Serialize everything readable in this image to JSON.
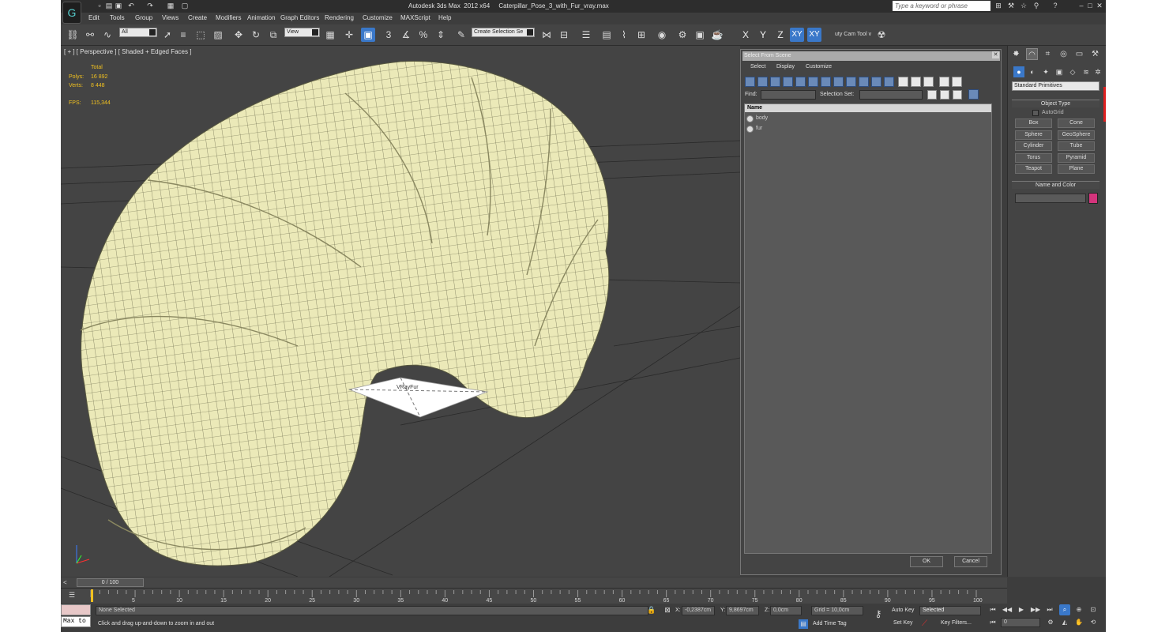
{
  "title": {
    "app": "Autodesk 3ds Max  2012 x64",
    "file": "Caterpillar_Pose_3_with_Fur_vray.max",
    "search_placeholder": "Type a keyword or phrase"
  },
  "menu": [
    "Edit",
    "Tools",
    "Group",
    "Views",
    "Create",
    "Modifiers",
    "Animation",
    "Graph Editors",
    "Rendering",
    "Customize",
    "MAXScript",
    "Help"
  ],
  "toolbar": {
    "filter_dropdown": "All",
    "refcoord_dropdown": "View",
    "snap_label": "3",
    "selection_set": "Create Selection Se",
    "axes": [
      "X",
      "Y",
      "Z",
      "XY",
      "XY"
    ],
    "cam_tool": "uty Cam Tool v"
  },
  "viewport": {
    "label": "[ + ] [ Perspective ] [ Shaded + Edged Faces ]",
    "stats": {
      "total_label": "Total",
      "polys_label": "Polys:",
      "polys_value": "16 892",
      "verts_label": "Verts:",
      "verts_value": "8 448",
      "fps_label": "FPS:",
      "fps_value": "115,344"
    },
    "helper_label": "VRayFur"
  },
  "dialog": {
    "title": "Select From Scene",
    "menu": [
      "Select",
      "Display",
      "Customize"
    ],
    "find_label": "Find:",
    "selset_label": "Selection Set:",
    "column_header": "Name",
    "rows": [
      "body",
      "fur"
    ],
    "ok": "OK",
    "cancel": "Cancel"
  },
  "command_panel": {
    "category": "Standard Primitives",
    "object_type_title": "Object Type",
    "autogrid": "AutoGrid",
    "buttons": [
      "Box",
      "Cone",
      "Sphere",
      "GeoSphere",
      "Cylinder",
      "Tube",
      "Torus",
      "Pyramid",
      "Teapot",
      "Plane"
    ],
    "name_color_title": "Name and Color",
    "color": "#d4347c"
  },
  "timeline": {
    "slider": "0 / 100",
    "ticks": [
      "5",
      "10",
      "15",
      "20",
      "25",
      "30",
      "35",
      "40",
      "45",
      "50",
      "55",
      "60",
      "65",
      "70",
      "75",
      "80",
      "85",
      "90",
      "95",
      "100"
    ]
  },
  "status": {
    "maxscript": "Max to",
    "selection": "None Selected",
    "prompt": "Click and drag up-and-down to zoom in and out",
    "x_label": "X:",
    "x_value": "-0,2387cm",
    "y_label": "Y:",
    "y_value": "9,8697cm",
    "z_label": "Z:",
    "z_value": "0,0cm",
    "grid": "Grid = 10,0cm",
    "add_time_tag": "Add Time Tag",
    "auto_key": "Auto Key",
    "set_key": "Set Key",
    "key_mode": "Selected",
    "key_filters": "Key Filters...",
    "frame": "0"
  }
}
